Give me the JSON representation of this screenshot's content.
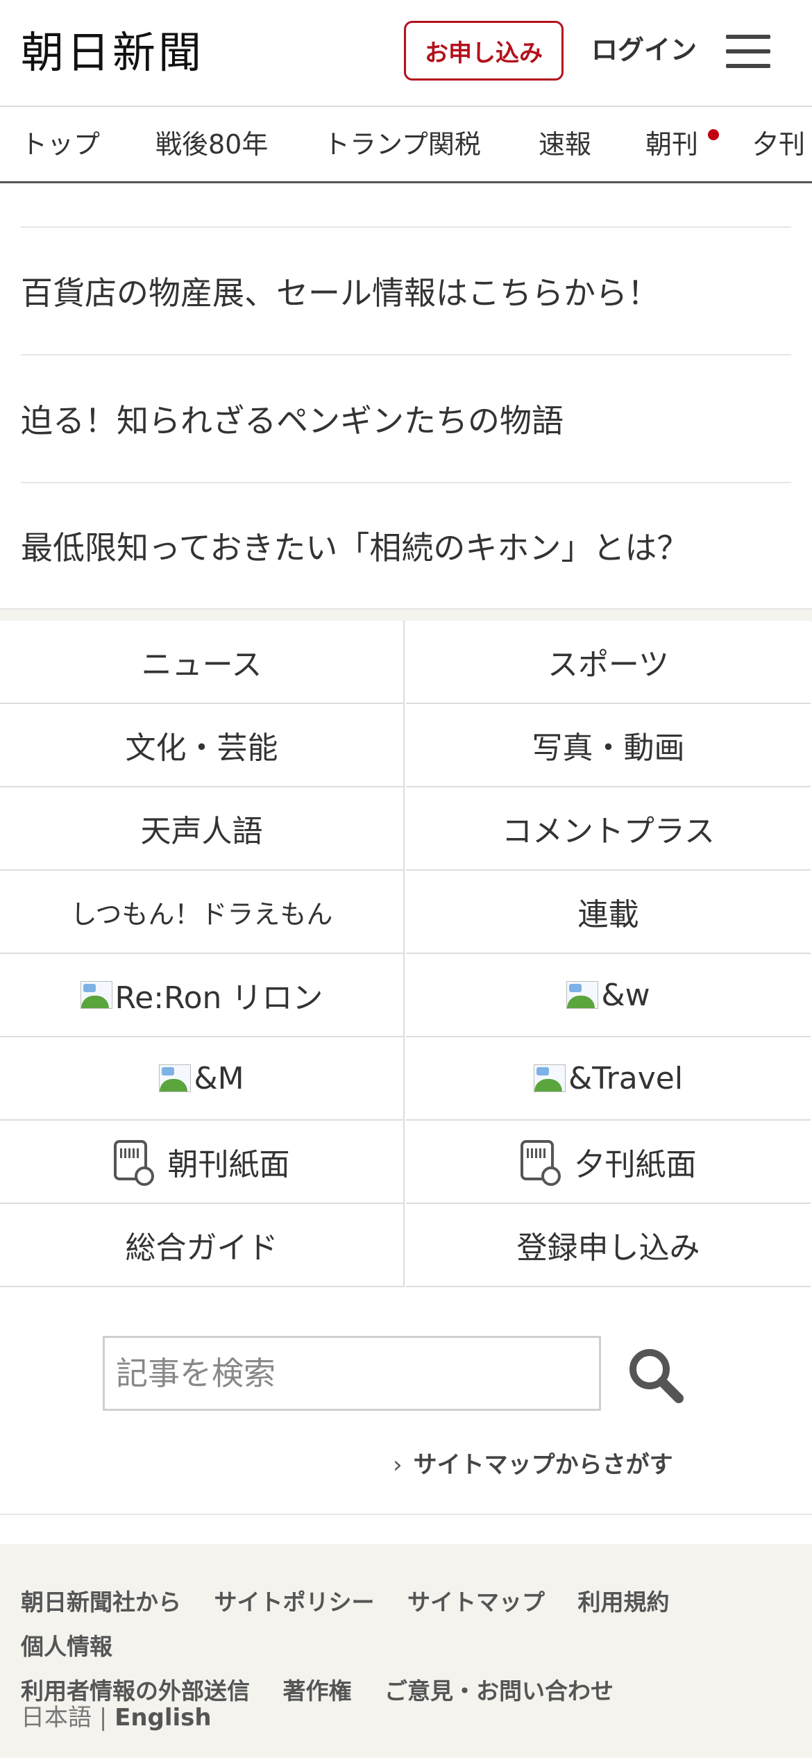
{
  "header": {
    "logo": "朝日新聞",
    "apply_label": "お申し込み",
    "login_label": "ログイン"
  },
  "nav": {
    "tabs": [
      "トップ",
      "戦後80年",
      "トランプ関税",
      "速報",
      "朝刊",
      "夕刊"
    ]
  },
  "promos": [
    "百貨店の物産展、セール情報はこちらから！",
    "迫る！知られざるペンギンたちの物語",
    "最低限知っておきたい「相続のキホン」とは？"
  ],
  "grid": {
    "news": "ニュース",
    "sports": "スポーツ",
    "culture": "文化・芸能",
    "photo_video": "写真・動画",
    "tenseijingo": "天声人語",
    "comment_plus": "コメントプラス",
    "doraemon": "しつもん！ドラえもん",
    "rensai": "連載",
    "reron": "Re:Ron リロン",
    "and_w": "&w",
    "and_m": "&M",
    "and_travel": "&Travel",
    "morning_paper": "朝刊紙面",
    "evening_paper": "夕刊紙面",
    "guide": "総合ガイド",
    "register": "登録申し込み"
  },
  "search": {
    "placeholder": "記事を検索",
    "sitemap_link": "サイトマップからさがす"
  },
  "footer": {
    "links": [
      "朝日新聞社から",
      "サイトポリシー",
      "サイトマップ",
      "利用規約",
      "個人情報",
      "利用者情報の外部送信",
      "著作権",
      "ご意見・お問い合わせ"
    ],
    "lang_ja": "日本語",
    "lang_sep": "|",
    "lang_en": "English"
  },
  "colors": {
    "brand_red": "#b3121b",
    "footer_bg": "#f4f3ee"
  },
  "icons": [
    "hamburger-menu-icon",
    "search-icon",
    "morning-paper-icon",
    "evening-paper-icon",
    "broken-image-icon"
  ]
}
